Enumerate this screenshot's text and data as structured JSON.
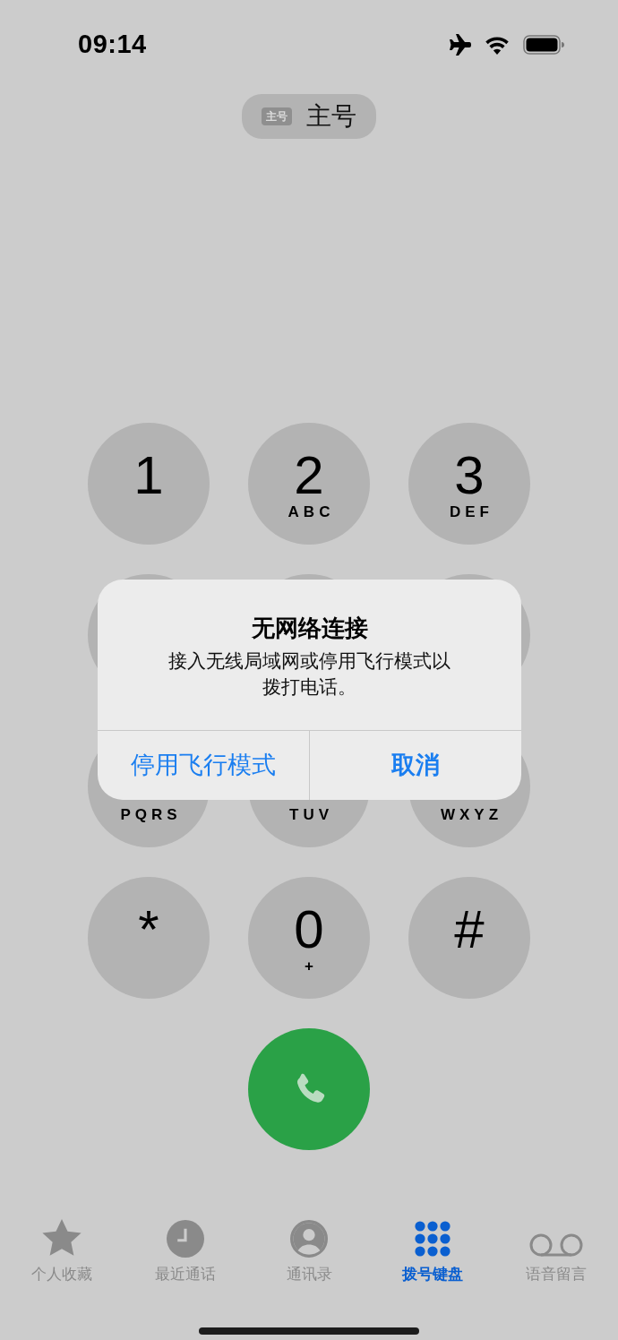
{
  "status_bar": {
    "time": "09:14"
  },
  "line_selector": {
    "badge": "主号",
    "label": "主号"
  },
  "keypad": {
    "keys": [
      {
        "digit": "1"
      },
      {
        "digit": "2",
        "letters": "ABC"
      },
      {
        "digit": "3",
        "letters": "DEF"
      },
      {
        "letters": "PQRS"
      },
      {
        "letters": "TUV"
      },
      {
        "letters": "WXYZ"
      },
      {
        "digit": "*"
      },
      {
        "digit": "0",
        "letters": "+"
      },
      {
        "digit": "#"
      }
    ]
  },
  "alert": {
    "title": "无网络连接",
    "message": "接入无线局域网或停用飞行模式以拨打电话。",
    "buttons": [
      {
        "label": "停用飞行模式",
        "kind": "default"
      },
      {
        "label": "取消",
        "kind": "preferred"
      }
    ]
  },
  "tabs": [
    {
      "label": "个人收藏",
      "selected": false
    },
    {
      "label": "最近通话",
      "selected": false
    },
    {
      "label": "通讯录",
      "selected": false
    },
    {
      "label": "拨号键盘",
      "selected": true
    },
    {
      "label": "语音留言",
      "selected": false
    }
  ]
}
